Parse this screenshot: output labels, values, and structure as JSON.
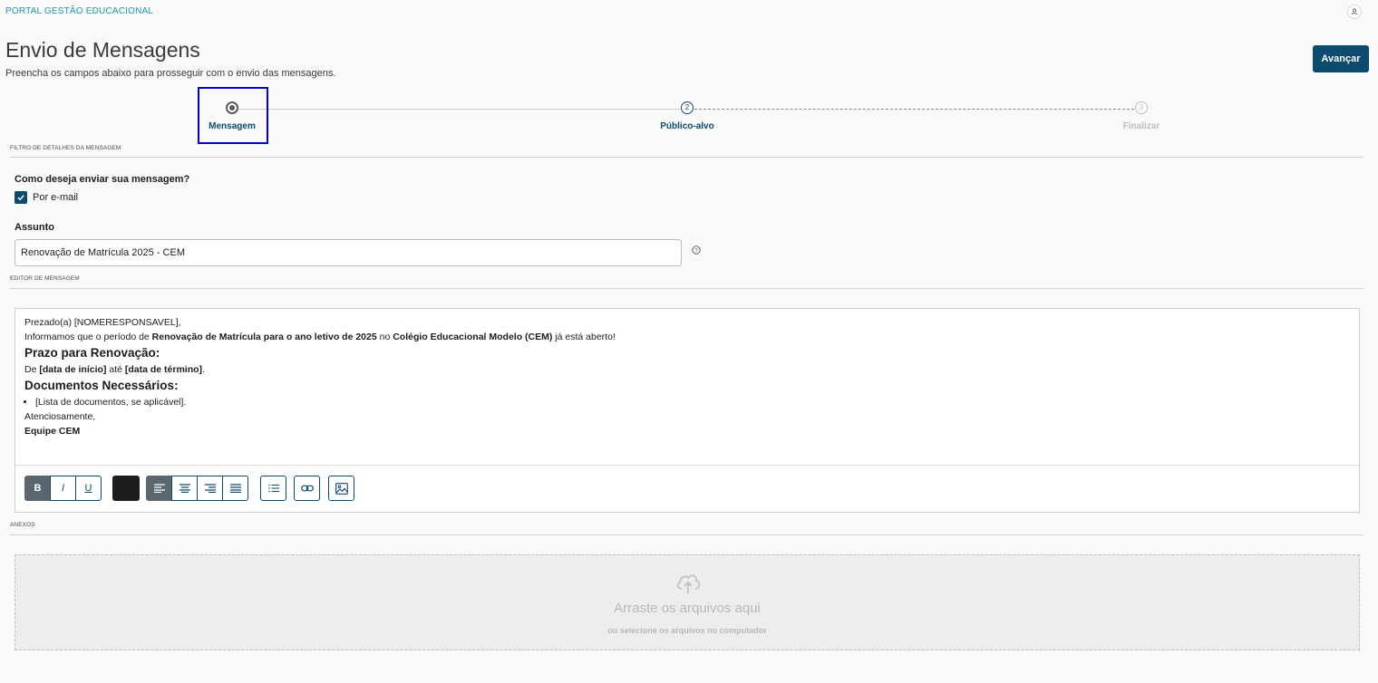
{
  "header": {
    "portal_name": "PORTAL GESTÃO EDUCACIONAL",
    "user_icon": "user-icon"
  },
  "page": {
    "title": "Envio de Mensagens",
    "subtitle": "Preencha os campos abaixo para prosseguir com o envio das mensagens.",
    "advance_label": "Avançar"
  },
  "stepper": {
    "steps": [
      {
        "number": "1",
        "label": "Mensagem",
        "state": "current"
      },
      {
        "number": "2",
        "label": "Público-alvo",
        "state": "next"
      },
      {
        "number": "3",
        "label": "Finalizar",
        "state": "disabled"
      }
    ]
  },
  "sections": {
    "details": "FILTRO DE DETALHES DA MENSAGEM",
    "editor": "EDITOR DE MENSAGEM",
    "attachments": "ANEXOS"
  },
  "send_method": {
    "question": "Como deseja enviar sua mensagem?",
    "option_label": "Por e-mail",
    "checked": true
  },
  "subject": {
    "label": "Assunto",
    "value": "Renovação de Matrícula 2025 - CEM"
  },
  "message": {
    "greeting": "Prezado(a) [NOMERESPONSAVEL],",
    "intro_prefix": "Informamos que o período de ",
    "intro_bold1": "Renovação de Matrícula para o ano letivo de 2025",
    "intro_mid": " no ",
    "intro_bold2": "Colégio Educacional Modelo (CEM)",
    "intro_suffix": " já está aberto!",
    "heading1": "Prazo para Renovação:",
    "dates_prefix": "De ",
    "dates_start": "[data de início]",
    "dates_mid": " até ",
    "dates_end": "[data de término]",
    "dates_suffix": ".",
    "heading2": "Documentos Necessários:",
    "doc_item": "[Lista de documentos, se aplicável].",
    "closing": "Atenciosamente,",
    "signature": "Equipe CEM"
  },
  "toolbar": {
    "bold": "B",
    "italic": "I",
    "underline": "U",
    "text_color": "#1d1d1d"
  },
  "dropzone": {
    "title": "Arraste os arquivos aqui",
    "subtitle": "ou selecione os arquivos no computador",
    "icon": "cloud-upload-icon"
  },
  "colors": {
    "primary": "#0c4a6e",
    "accent": "#1b9aaa",
    "highlight": "#0000cc"
  }
}
